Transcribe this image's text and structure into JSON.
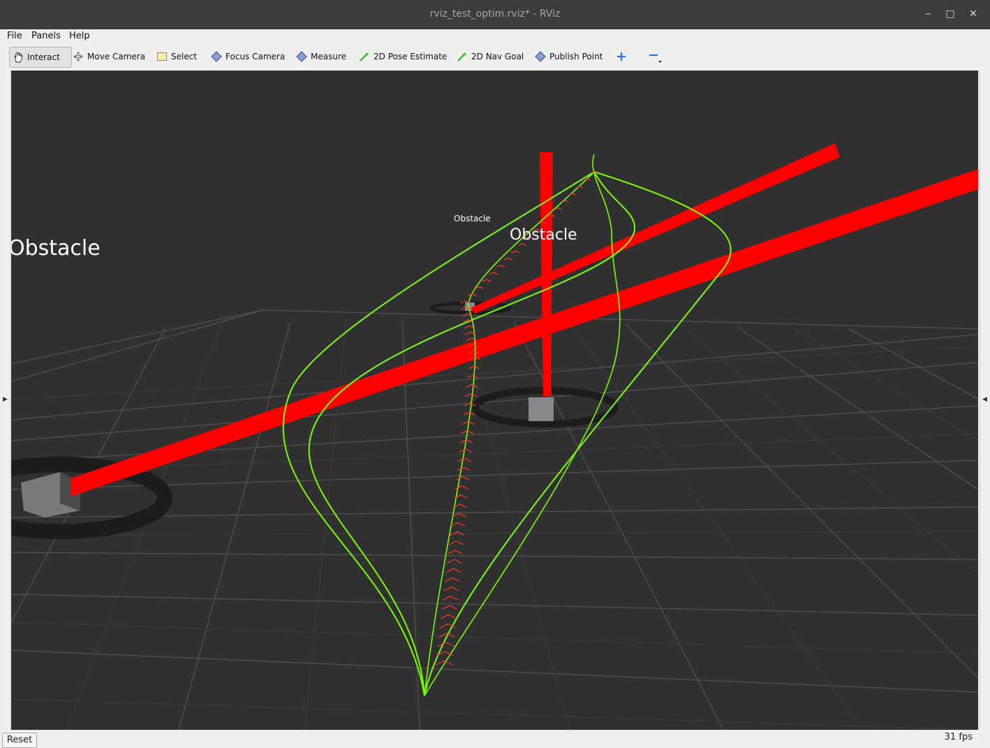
{
  "window": {
    "title": "rviz_test_optim.rviz* - RViz",
    "controls": {
      "minimize": "‒",
      "maximize": "□",
      "close": "✕"
    }
  },
  "menubar": {
    "items": [
      "File",
      "Panels",
      "Help"
    ]
  },
  "toolbar": {
    "tools": [
      {
        "label": "Interact",
        "icon": "hand-icon",
        "active": true
      },
      {
        "label": "Move Camera",
        "icon": "move-camera-icon"
      },
      {
        "label": "Select",
        "icon": "select-icon"
      },
      {
        "label": "Focus Camera",
        "icon": "focus-camera-icon"
      },
      {
        "label": "Measure",
        "icon": "measure-icon"
      },
      {
        "label": "2D Pose Estimate",
        "icon": "pose-estimate-icon"
      },
      {
        "label": "2D Nav Goal",
        "icon": "nav-goal-icon"
      },
      {
        "label": "Publish Point",
        "icon": "publish-point-icon"
      }
    ],
    "add_tool_icon": "plus-icon",
    "remove_tool_icon": "minus-icon"
  },
  "viewport": {
    "labels": [
      "Obstacle",
      "Obstacle",
      "Obstacle"
    ],
    "colors": {
      "background": "#303030",
      "grid": "#5e5e5e",
      "trajectory": "#7cfc00",
      "obstacle_marker": "#ff0000",
      "pose_arrows": "#ff2a2a"
    }
  },
  "statusbar": {
    "reset_label": "Reset",
    "fps": "31 fps"
  }
}
